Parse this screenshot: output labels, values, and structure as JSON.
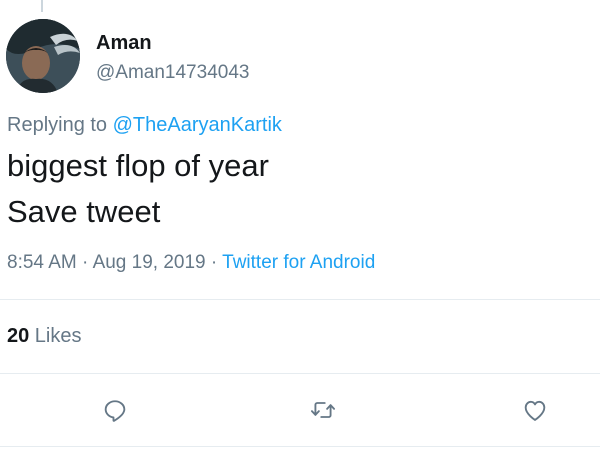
{
  "author": {
    "name": "Aman",
    "handle": "@Aman14734043",
    "avatar_icon": "profile-photo"
  },
  "reply": {
    "prefix": "Replying to ",
    "mention": "@TheAaryanKartik"
  },
  "tweet": {
    "lines": [
      "biggest flop of year",
      "Save tweet"
    ]
  },
  "meta": {
    "time": "8:54 AM",
    "sep1": " · ",
    "date": "Aug 19, 2019",
    "sep2": " · ",
    "source": "Twitter for Android"
  },
  "stats": {
    "likes_count": "20",
    "likes_label": " Likes"
  },
  "actions": {
    "reply_icon": "reply-icon",
    "retweet_icon": "retweet-icon",
    "like_icon": "heart-icon"
  },
  "colors": {
    "link": "#1da1f2",
    "secondary_text": "#657786",
    "primary_text": "#14171a",
    "divider": "#e6ecf0",
    "icon": "#657786"
  }
}
